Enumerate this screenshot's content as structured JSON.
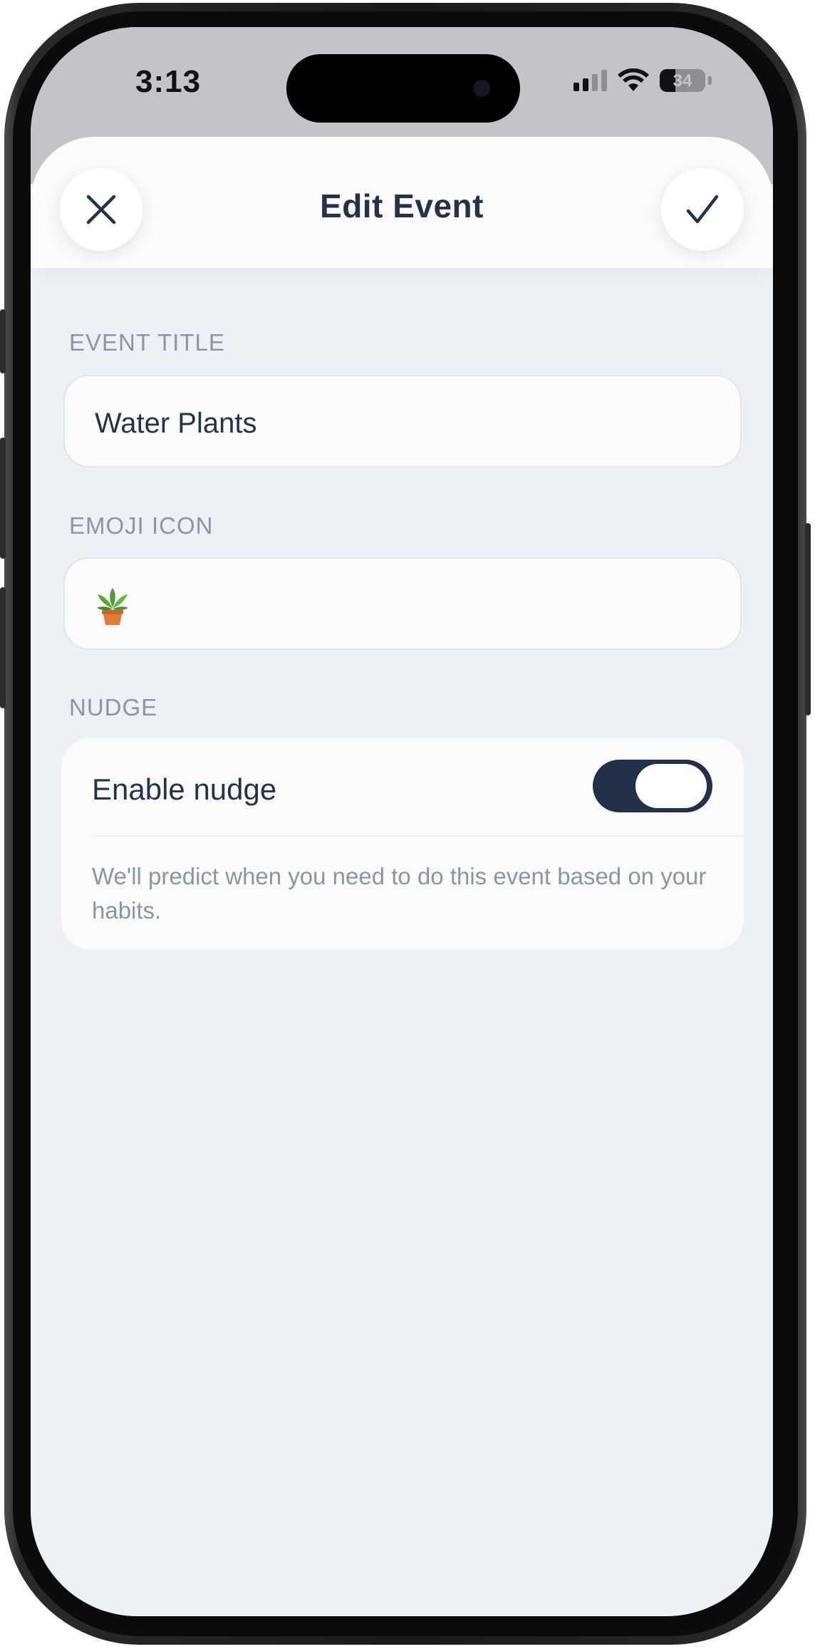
{
  "status_bar": {
    "time": "3:13",
    "battery": "34",
    "battery_level": 0.34,
    "icons": [
      "cellular-signal-icon",
      "wifi-icon",
      "battery-icon"
    ]
  },
  "header": {
    "title": "Edit Event",
    "close_icon": "close-icon",
    "confirm_icon": "checkmark-icon"
  },
  "event_title": {
    "label": "EVENT TITLE",
    "value": "Water Plants"
  },
  "emoji_icon": {
    "label": "EMOJI ICON",
    "value_icon": "potted-plant-emoji"
  },
  "nudge": {
    "section_label": "NUDGE",
    "toggle_label": "Enable nudge",
    "enabled": true,
    "description": "We'll predict when you need to do this event based on your habits."
  },
  "colors": {
    "text_primary": "#253349",
    "text_secondary": "#8c94a8",
    "toggle_on": "#22304a",
    "background": "#edf0f4",
    "card": "#fbfbfc"
  }
}
